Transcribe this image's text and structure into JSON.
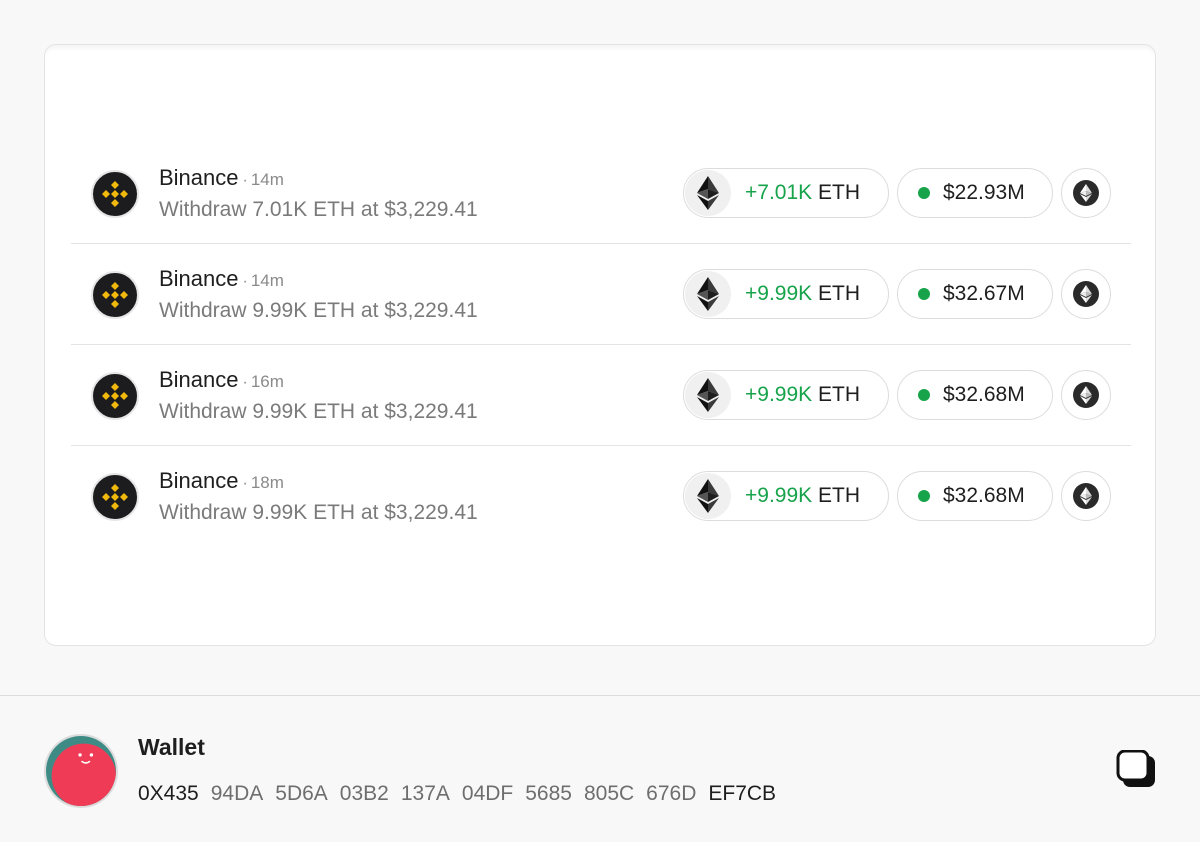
{
  "transactions": [
    {
      "exchange": "Binance",
      "time": "14m",
      "description": "Withdraw 7.01K ETH at $3,229.41",
      "amount": "+7.01K",
      "unit": "ETH",
      "usd": "$22.93M"
    },
    {
      "exchange": "Binance",
      "time": "14m",
      "description": "Withdraw 9.99K ETH at $3,229.41",
      "amount": "+9.99K",
      "unit": "ETH",
      "usd": "$32.67M"
    },
    {
      "exchange": "Binance",
      "time": "16m",
      "description": "Withdraw 9.99K ETH at $3,229.41",
      "amount": "+9.99K",
      "unit": "ETH",
      "usd": "$32.68M"
    },
    {
      "exchange": "Binance",
      "time": "18m",
      "description": "Withdraw 9.99K ETH at $3,229.41",
      "amount": "+9.99K",
      "unit": "ETH",
      "usd": "$32.68M"
    }
  ],
  "separator": "·",
  "icons": {
    "exchange_logo": "binance-logo-icon",
    "token": "ethereum-icon",
    "chain": "ethereum-chain-icon",
    "status": "green-dot-icon",
    "copy": "copy-icon",
    "avatar": "wallet-avatar-icon"
  },
  "colors": {
    "positive": "#16a34a",
    "binance_yellow": "#f0b90b",
    "avatar_red": "#ef3b55",
    "avatar_teal": "#3e8b86"
  },
  "wallet": {
    "title": "Wallet",
    "address_groups": [
      "0X435",
      "94DA",
      "5D6A",
      "03B2",
      "137A",
      "04DF",
      "5685",
      "805C",
      "676D",
      "EF7CB"
    ]
  }
}
